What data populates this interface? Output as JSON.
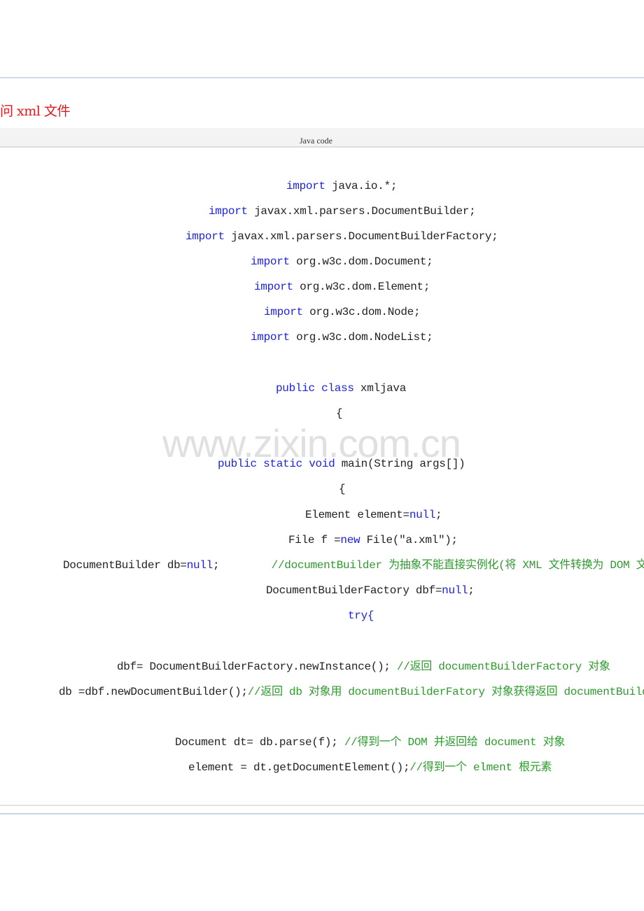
{
  "heading": "问 xml 文件",
  "code_block": {
    "header_label": "Java code",
    "lines": [
      {
        "parts": [
          {
            "t": "import",
            "k": "kw"
          },
          {
            "t": " java.io.*;",
            "k": ""
          }
        ]
      },
      {
        "parts": [
          {
            "t": "import",
            "k": "kw"
          },
          {
            "t": " javax.xml.parsers.DocumentBuilder;",
            "k": ""
          }
        ]
      },
      {
        "parts": [
          {
            "t": "import",
            "k": "kw"
          },
          {
            "t": " javax.xml.parsers.DocumentBuilderFactory;",
            "k": ""
          }
        ]
      },
      {
        "parts": [
          {
            "t": "import",
            "k": "kw"
          },
          {
            "t": " org.w3c.dom.Document;",
            "k": ""
          }
        ]
      },
      {
        "parts": [
          {
            "t": "import",
            "k": "kw"
          },
          {
            "t": " org.w3c.dom.Element;",
            "k": ""
          }
        ]
      },
      {
        "parts": [
          {
            "t": "import",
            "k": "kw"
          },
          {
            "t": " org.w3c.dom.Node;",
            "k": ""
          }
        ]
      },
      {
        "parts": [
          {
            "t": "import",
            "k": "kw"
          },
          {
            "t": " org.w3c.dom.NodeList;",
            "k": ""
          }
        ]
      },
      {
        "parts": [
          {
            "t": "public class",
            "k": "kw"
          },
          {
            "t": " xmljava",
            "k": ""
          }
        ]
      },
      {
        "parts": [
          {
            "t": "{",
            "k": ""
          }
        ]
      },
      {
        "parts": [
          {
            "t": "public static void",
            "k": "kw"
          },
          {
            "t": " main(String args[])",
            "k": ""
          }
        ]
      },
      {
        "parts": [
          {
            "t": "{",
            "k": ""
          }
        ]
      },
      {
        "parts": [
          {
            "t": "Element element=",
            "k": ""
          },
          {
            "t": "null",
            "k": "kw"
          },
          {
            "t": ";",
            "k": ""
          }
        ]
      },
      {
        "parts": [
          {
            "t": "File f =",
            "k": ""
          },
          {
            "t": "new",
            "k": "kw"
          },
          {
            "t": " File(\"a.xml\");",
            "k": ""
          }
        ]
      },
      {
        "parts": [
          {
            "t": "DocumentBuilder db=",
            "k": ""
          },
          {
            "t": "null",
            "k": "kw"
          },
          {
            "t": ";        ",
            "k": ""
          },
          {
            "t": "//documentBuilder 为抽象不能直接实例化(将 XML 文件转换为 DOM 文件)",
            "k": "cm"
          }
        ]
      },
      {
        "parts": [
          {
            "t": "DocumentBuilderFactory dbf=",
            "k": ""
          },
          {
            "t": "null",
            "k": "kw"
          },
          {
            "t": ";",
            "k": ""
          }
        ]
      },
      {
        "parts": [
          {
            "t": "try{",
            "k": "kw"
          }
        ]
      },
      {
        "parts": [
          {
            "t": "dbf= DocumentBuilderFactory.newInstance(); ",
            "k": ""
          },
          {
            "t": "//返回 documentBuilderFactory 对象",
            "k": "cm"
          }
        ]
      },
      {
        "parts": [
          {
            "t": "db =dbf.newDocumentBuilder();",
            "k": ""
          },
          {
            "t": "//返回 db 对象用 documentBuilderFatory 对象获得返回 documentBuilder 对象",
            "k": "cm"
          }
        ]
      },
      {
        "parts": [
          {
            "t": "Document dt= db.parse(f); ",
            "k": ""
          },
          {
            "t": "//得到一个 DOM 并返回给 document 对象",
            "k": "cm"
          }
        ]
      },
      {
        "parts": [
          {
            "t": "element = dt.getDocumentElement();",
            "k": ""
          },
          {
            "t": "//得到一个 elment 根元素",
            "k": "cm"
          }
        ]
      }
    ]
  },
  "watermark": "www.zixin.com.cn",
  "colors": {
    "heading": "#e8161b",
    "keyword": "#1f22e0",
    "comment": "#2e9a2e",
    "text": "#222222"
  }
}
